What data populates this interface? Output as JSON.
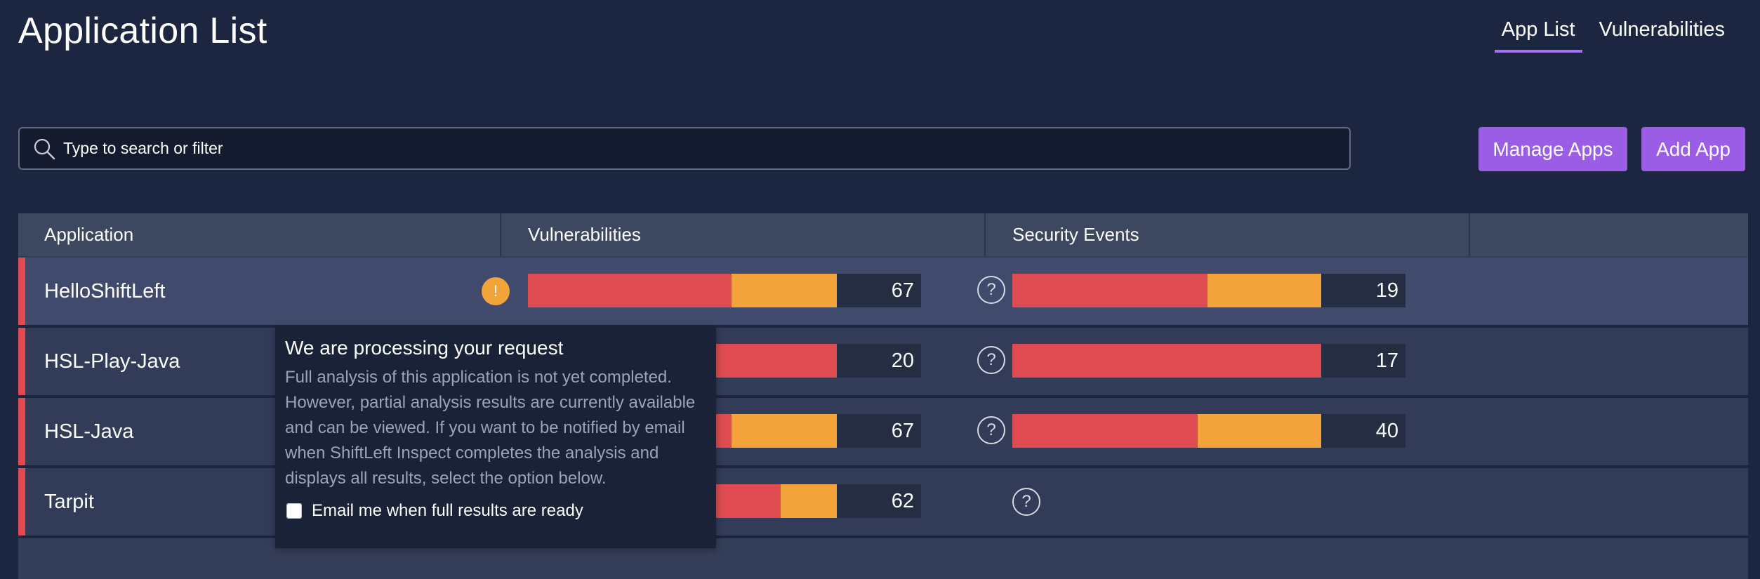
{
  "header": {
    "title": "Application List",
    "tabs": [
      {
        "label": "App List",
        "active": true
      },
      {
        "label": "Vulnerabilities",
        "active": false
      }
    ]
  },
  "search": {
    "placeholder": "Type to search or filter",
    "value": ""
  },
  "actions": {
    "manage_label": "Manage Apps",
    "add_label": "Add App"
  },
  "table": {
    "columns": [
      "Application",
      "Vulnerabilities",
      "Security Events"
    ],
    "rows": [
      {
        "name": "HelloShiftLeft",
        "vulnerabilities": 67,
        "security_events": 19,
        "selected": true,
        "status_icon": "warning-icon"
      },
      {
        "name": "HSL-Play-Java",
        "vulnerabilities": 20,
        "security_events": 17
      },
      {
        "name": "HSL-Java",
        "vulnerabilities": 67,
        "security_events": 40
      },
      {
        "name": "Tarpit",
        "vulnerabilities": 62,
        "security_events": null
      }
    ]
  },
  "popover": {
    "title": "We are processing your request",
    "body": "Full analysis of this application is not yet completed. However, partial analysis results are currently available and can be viewed. If you want to be notified by email when ShiftLeft Inspect completes the analysis and displays all results, select the option below.",
    "checkbox_label": "Email me when full results are ready",
    "checkbox_checked": false
  },
  "colors": {
    "accent": "#9b5de5",
    "critical": "#de4c51",
    "moderate": "#f2a33a",
    "background": "#1d2640"
  }
}
